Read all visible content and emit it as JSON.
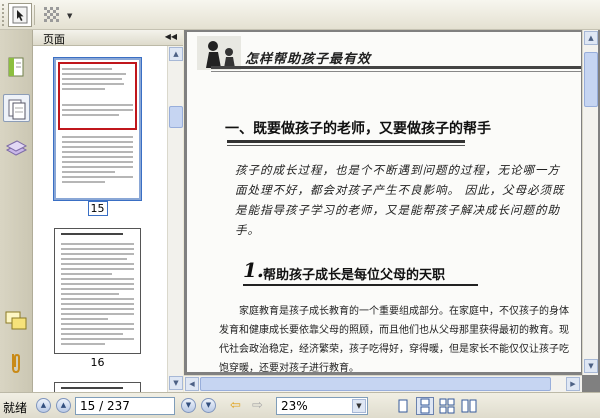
{
  "panel": {
    "title": "页面",
    "thumbnails": [
      {
        "label": "15",
        "selected": true
      },
      {
        "label": "16",
        "selected": false
      }
    ]
  },
  "page": {
    "header_title": "怎样帮助孩子最有效",
    "section_title": "一、既要做孩子的老师，又要做孩子的帮手",
    "script_text": "孩子的成长过程，也是个不断遇到问题的过程，无论哪一方面处理不好，都会对孩子产生不良影响。 因此，父母必须既是能指导孩子学习的老师，又是能帮孩子解决成长问题的助手。",
    "subsection_number": "1.",
    "subsection_title": "帮助孩子成长是每位父母的天职",
    "body_text": "家庭教育是孩子成长教育的一个重要组成部分。在家庭中，不仅孩子的身体发育和健康成长要依靠父母的照顾，而且他们也从父母那里获得最初的教育。现代社会政治稳定，经济繁荣，孩子吃得好，穿得暖，但是家长不能仅仅让孩子吃饱穿暖，还要对孩子进行教育。"
  },
  "status": {
    "ready": "就绪",
    "page_indicator": "15 / 237",
    "zoom": "23%"
  },
  "colors": {
    "accent": "#3a6fc4",
    "highlight_red": "#c0161c"
  }
}
